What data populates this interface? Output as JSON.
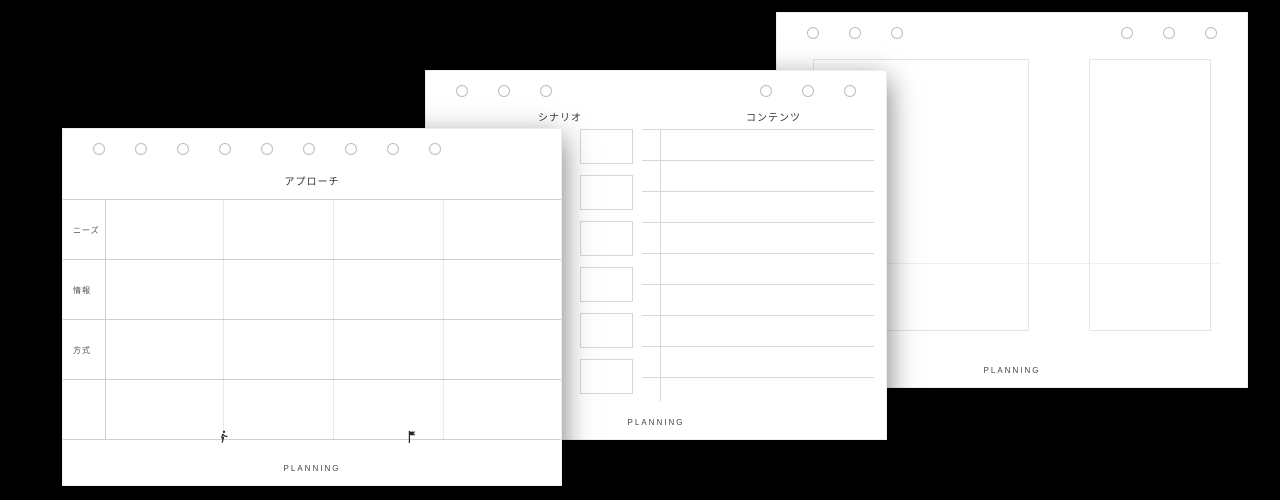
{
  "footer": "PLANNING",
  "card1": {
    "title": "アプローチ",
    "rows": [
      "ニーズ",
      "情報",
      "方式"
    ]
  },
  "card2": {
    "left_title": "シナリオ",
    "right_title": "コンテンツ"
  }
}
